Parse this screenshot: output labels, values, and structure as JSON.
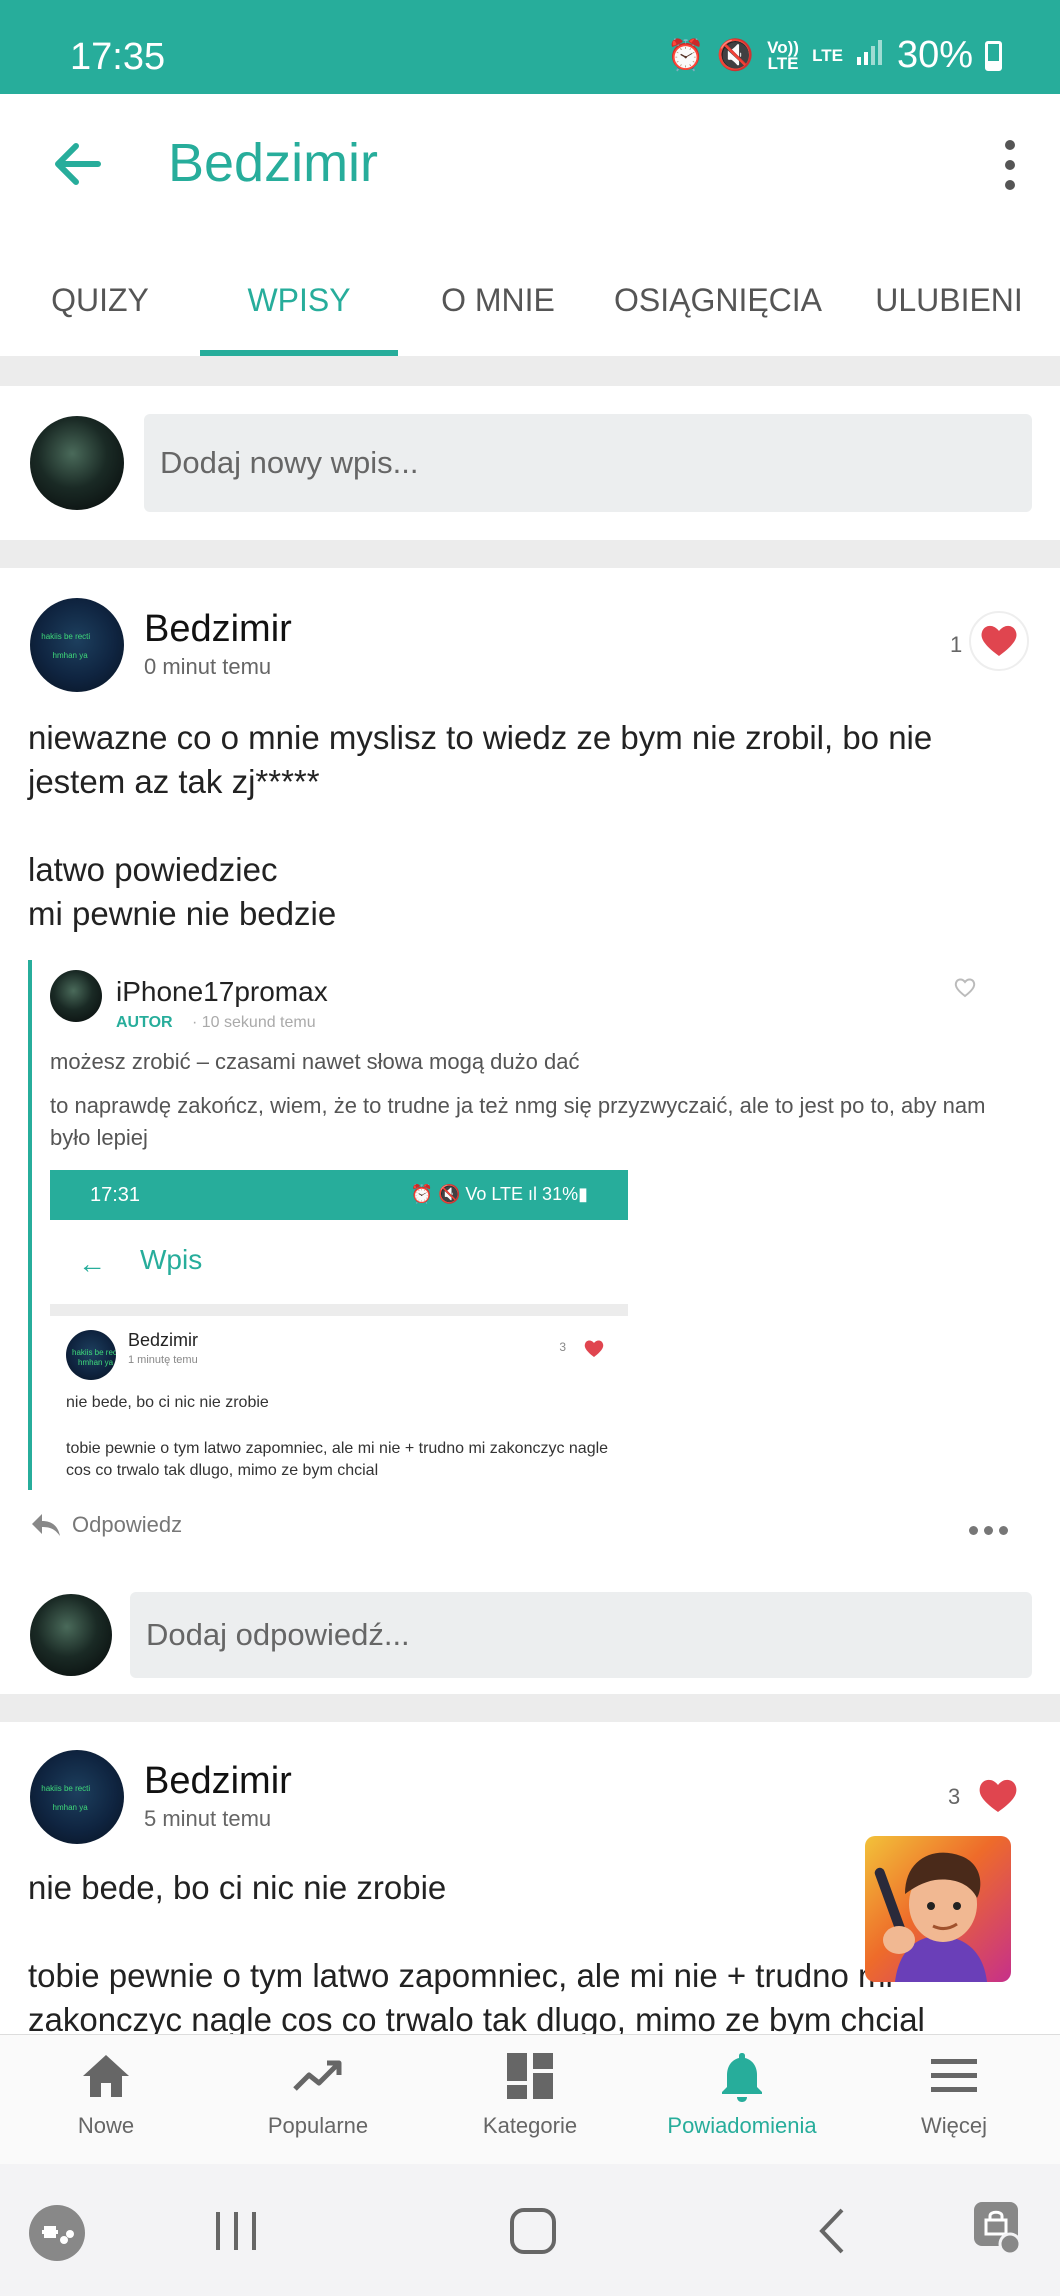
{
  "status_bar": {
    "time": "17:35",
    "volte": "Vo)) LTE",
    "lte": "LTE",
    "battery": "30%"
  },
  "header": {
    "title": "Bedzimir"
  },
  "tabs": [
    {
      "label": "QUIZY",
      "active": false
    },
    {
      "label": "WPISY",
      "active": true
    },
    {
      "label": "O MNIE",
      "active": false
    },
    {
      "label": "OSIĄGNIĘCIA",
      "active": false
    },
    {
      "label": "ULUBIENI",
      "active": false
    }
  ],
  "new_post": {
    "placeholder": "Dodaj nowy wpis..."
  },
  "posts": [
    {
      "author": "Bedzimir",
      "time": "0 minut temu",
      "likes": "1",
      "text": "niewazne co o mnie myslisz to wiedz ze bym nie zrobil, bo nie\njestem az tak zj*****\n\nlatwo powiedziec\nmi pewnie nie bedzie",
      "quote": {
        "author": "iPhone17promax",
        "role": "AUTOR",
        "time": "· 10 sekund temu",
        "line1": "możesz zrobić – czasami nawet słowa mogą dużo dać",
        "line2": "to naprawdę zakończ, wiem, że to trudne ja też nmg się przyzwyczaić, ale to jest po to, aby nam było lepiej",
        "screenshot": {
          "time": "17:31",
          "status_icons": "⏰ 🔇 Vo LTE ıl 31%▮",
          "title": "Wpis",
          "author": "Bedzimir",
          "post_time": "1 minutę temu",
          "likes": "3",
          "text1": "nie bede, bo ci nic nie zrobie",
          "text2": "tobie pewnie o tym latwo zapomniec, ale mi nie + trudno mi zakonczyc nagle cos co trwalo tak dlugo, mimo ze bym chcial"
        }
      },
      "reply_label": "Odpowiedz",
      "reply_placeholder": "Dodaj odpowiedź..."
    },
    {
      "author": "Bedzimir",
      "time": "5 minut temu",
      "likes": "3",
      "text": "nie bede, bo ci nic nie zrobie\n\ntobie pewnie o tym latwo zapomniec, ale mi nie + trudno mi\nzakonczyc nagle cos co trwalo tak dlugo, mimo ze bym chcial"
    }
  ],
  "bottom_nav": [
    {
      "label": "Nowe",
      "icon": "home-icon",
      "active": false
    },
    {
      "label": "Popularne",
      "icon": "trending-icon",
      "active": false
    },
    {
      "label": "Kategorie",
      "icon": "dashboard-icon",
      "active": false
    },
    {
      "label": "Powiadomienia",
      "icon": "bell-icon",
      "active": true
    },
    {
      "label": "Więcej",
      "icon": "menu-icon",
      "active": false
    }
  ],
  "colors": {
    "accent": "#27ad9b",
    "heart": "#e0454f"
  }
}
